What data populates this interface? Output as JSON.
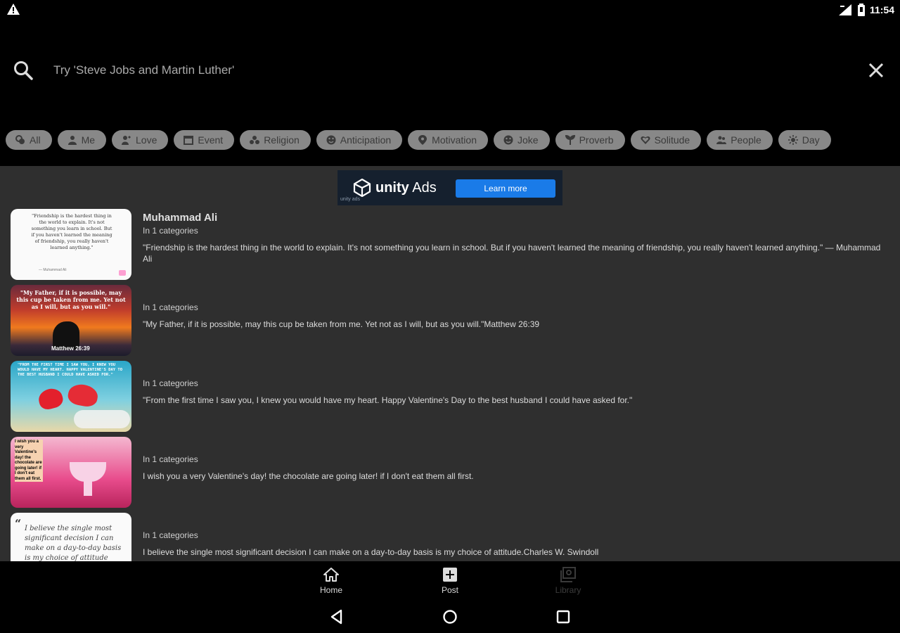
{
  "status": {
    "time": "11:54",
    "icons": [
      "warning-icon",
      "signal-icon",
      "battery-icon"
    ]
  },
  "search": {
    "placeholder": "Try 'Steve Jobs and Martin Luther'",
    "icon": "search-icon",
    "clear_icon": "close-icon"
  },
  "chips": [
    {
      "label": "All",
      "icon": "all-icon"
    },
    {
      "label": "Me",
      "icon": "person-icon"
    },
    {
      "label": "Love",
      "icon": "love-icon"
    },
    {
      "label": "Event",
      "icon": "calendar-icon"
    },
    {
      "label": "Religion",
      "icon": "religion-icon"
    },
    {
      "label": "Anticipation",
      "icon": "smiley-icon"
    },
    {
      "label": "Motivation",
      "icon": "pin-icon"
    },
    {
      "label": "Joke",
      "icon": "smiley-icon"
    },
    {
      "label": "Proverb",
      "icon": "plant-icon"
    },
    {
      "label": "Solitude",
      "icon": "heart-icon"
    },
    {
      "label": "People",
      "icon": "people-icon"
    },
    {
      "label": "Day",
      "icon": "sun-icon"
    }
  ],
  "ad": {
    "brand": "unity",
    "brand_suffix": "Ads",
    "button": "Learn more",
    "small": "unity ads"
  },
  "quotes": [
    {
      "author": "Muhammad Ali",
      "categories": "In 1 categories",
      "text": "\"Friendship is the hardest thing in the world to explain. It's not something you learn in school. But if you haven't learned the meaning of friendship, you really haven't learned anything.\" ― Muhammad Ali",
      "thumb_text": "\"Friendship is the hardest thing in the world to explain. It's not something you learn in school. But if you haven't learned the meaning of friendship, you really haven't learned anything.\"",
      "thumb_foot": "— Muhammad Ali"
    },
    {
      "author": "",
      "categories": "In 1 categories",
      "text": "\"My Father, if it is possible, may this cup be taken from me. Yet not as I will, but as you will.\"Matthew 26:39",
      "thumb_text": "\"My Father, if it is possible, may this cup be taken from me. Yet not as I will, but as you will.\"",
      "thumb_foot": "Matthew 26:39"
    },
    {
      "author": "",
      "categories": "In 1 categories",
      "text": "\"From the first time I saw you, I knew you would have my heart. Happy Valentine's Day to the best husband I could have asked for.\"",
      "thumb_text": "\"FROM THE FIRST TIME I SAW YOU, I KNEW YOU WOULD HAVE MY HEART. HAPPY VALENTINE'S DAY TO THE BEST HUSBAND I COULD HAVE ASKED FOR.\"",
      "thumb_foot": ""
    },
    {
      "author": "",
      "categories": "In 1 categories",
      "text": "I wish you a very Valentine's day! the chocolate are going later! if I don't eat them all first.",
      "thumb_text": "I wish you a very Valentine's day! the chocolate are going later! if I don't eat them all first.",
      "thumb_foot": ""
    },
    {
      "author": "",
      "categories": "In 1 categories",
      "text": "I believe the single most significant decision I can make on a day-to-day basis is my choice of attitude.Charles W. Swindoll",
      "thumb_text": "I believe the single most significant decision I can make on a day-to-day basis is my choice of attitude",
      "thumb_foot": ""
    }
  ],
  "bottom_nav": [
    {
      "label": "Home",
      "icon": "home-icon",
      "enabled": true
    },
    {
      "label": "Post",
      "icon": "add-box-icon",
      "enabled": true
    },
    {
      "label": "Library",
      "icon": "library-icon",
      "enabled": false
    }
  ],
  "system_nav": [
    "back-icon",
    "home-circle-icon",
    "recents-icon"
  ],
  "colors": {
    "content_bg": "#2f2f2f",
    "chip_bg": "#888888",
    "ad_button": "#1a7be8"
  }
}
